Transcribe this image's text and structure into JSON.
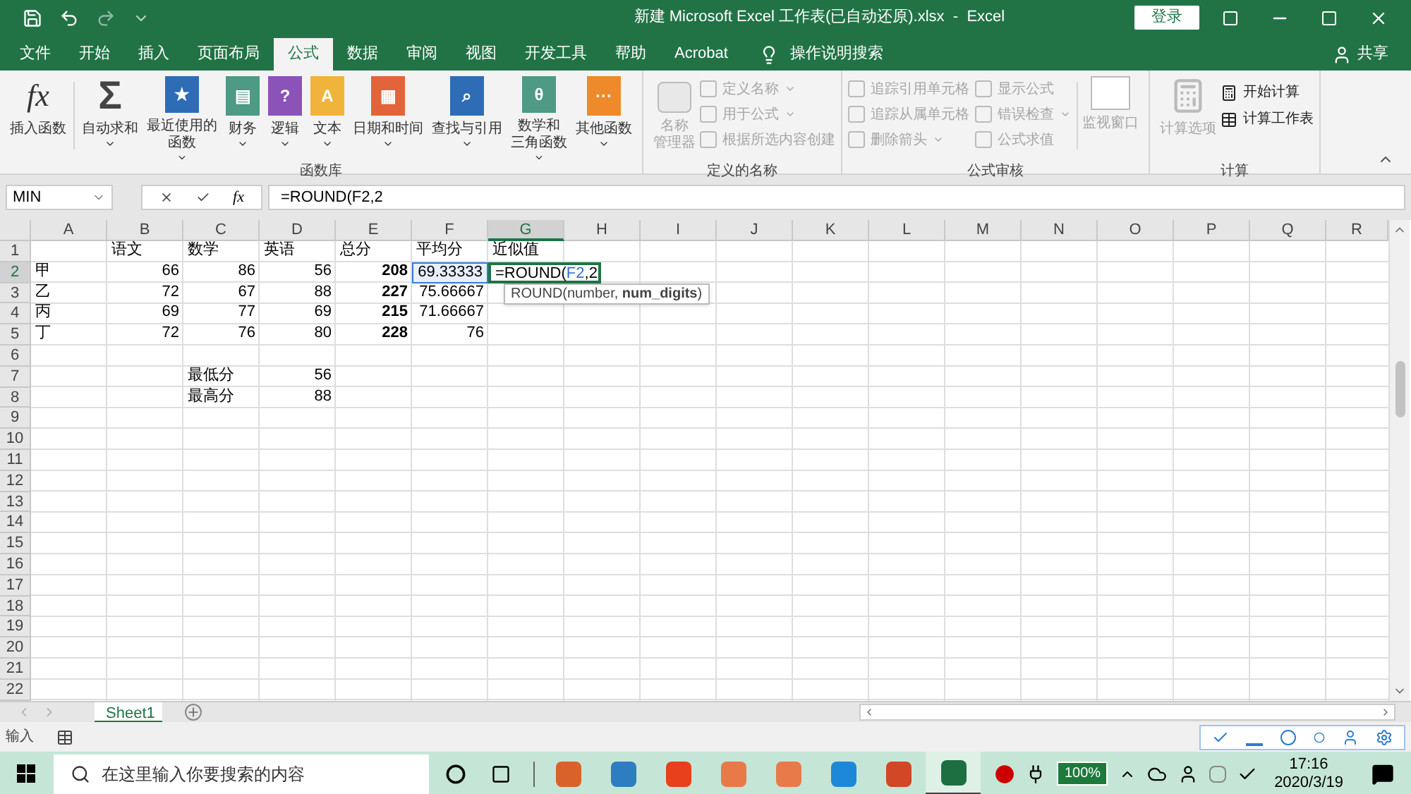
{
  "window": {
    "title": "新建 Microsoft Excel 工作表(已自动还原).xlsx  -  Excel",
    "signin": "登录"
  },
  "tabs": [
    {
      "label": "文件",
      "selected": false
    },
    {
      "label": "开始",
      "selected": false
    },
    {
      "label": "插入",
      "selected": false
    },
    {
      "label": "页面布局",
      "selected": false
    },
    {
      "label": "公式",
      "selected": true
    },
    {
      "label": "数据",
      "selected": false
    },
    {
      "label": "审阅",
      "selected": false
    },
    {
      "label": "视图",
      "selected": false
    },
    {
      "label": "开发工具",
      "selected": false
    },
    {
      "label": "帮助",
      "selected": false
    },
    {
      "label": "Acrobat",
      "selected": false
    }
  ],
  "tell_me": "操作说明搜索",
  "share": "共享",
  "ribbon": {
    "function_library": {
      "title": "函数库",
      "insert": {
        "lines": [
          "插入函数"
        ],
        "glyph": "fx"
      },
      "buttons": [
        {
          "lines": [
            "自动求和"
          ],
          "glyph": "Σ",
          "color": "#444444",
          "dropdown": true
        },
        {
          "lines": [
            "最近使用的",
            "函数"
          ],
          "glyph": "★",
          "color": "#2e6db5",
          "dropdown": true
        },
        {
          "lines": [
            "财务"
          ],
          "glyph": "▤",
          "color": "#4e9a84",
          "dropdown": true
        },
        {
          "lines": [
            "逻辑"
          ],
          "glyph": "?",
          "color": "#8b52b8",
          "dropdown": true
        },
        {
          "lines": [
            "文本"
          ],
          "glyph": "A",
          "color": "#f0b43c",
          "dropdown": true
        },
        {
          "lines": [
            "日期和时间"
          ],
          "glyph": "▦",
          "color": "#e2643a",
          "dropdown": true
        },
        {
          "lines": [
            "查找与引用"
          ],
          "glyph": "⌕",
          "color": "#2e6db5",
          "dropdown": true
        },
        {
          "lines": [
            "数学和",
            "三角函数"
          ],
          "glyph": "θ",
          "color": "#4e9a84",
          "dropdown": true
        },
        {
          "lines": [
            "其他函数"
          ],
          "glyph": "···",
          "color": "#ee8a2a",
          "dropdown": true
        }
      ]
    },
    "defined_names": {
      "title": "定义的名称",
      "manager": {
        "lines": [
          "名称",
          "管理器"
        ],
        "disabled": true
      },
      "items": [
        {
          "label": "定义名称",
          "dropdown": true,
          "disabled": true
        },
        {
          "label": "用于公式",
          "dropdown": true,
          "disabled": true
        },
        {
          "label": "根据所选内容创建",
          "dropdown": false,
          "disabled": true
        }
      ]
    },
    "auditing": {
      "title": "公式审核",
      "columns": [
        [
          {
            "label": "追踪引用单元格",
            "dropdown": false,
            "disabled": true
          },
          {
            "label": "追踪从属单元格",
            "dropdown": false,
            "disabled": true
          },
          {
            "label": "删除箭头",
            "dropdown": true,
            "disabled": true
          }
        ],
        [
          {
            "label": "显示公式",
            "dropdown": false,
            "disabled": true
          },
          {
            "label": "错误检查",
            "dropdown": true,
            "disabled": true
          },
          {
            "label": "公式求值",
            "dropdown": false,
            "disabled": true
          }
        ]
      ],
      "watch": {
        "lines": [
          "监视窗口"
        ],
        "disabled": true
      }
    },
    "calculation": {
      "title": "计算",
      "options": {
        "lines": [
          "计算选项"
        ],
        "disabled": true
      },
      "items": [
        {
          "label": "开始计算",
          "disabled": false
        },
        {
          "label": "计算工作表",
          "disabled": false
        }
      ]
    }
  },
  "formula_bar": {
    "name_box": "MIN",
    "fx": "fx",
    "formula": "=ROUND(F2,2"
  },
  "sheet": {
    "columns": [
      {
        "letter": "A",
        "selected": false
      },
      {
        "letter": "B",
        "selected": false
      },
      {
        "letter": "C",
        "selected": false
      },
      {
        "letter": "D",
        "selected": false
      },
      {
        "letter": "E",
        "selected": false
      },
      {
        "letter": "F",
        "selected": false
      },
      {
        "letter": "G",
        "selected": true
      },
      {
        "letter": "H",
        "selected": false
      },
      {
        "letter": "I",
        "selected": false
      },
      {
        "letter": "J",
        "selected": false
      },
      {
        "letter": "K",
        "selected": false
      },
      {
        "letter": "L",
        "selected": false
      },
      {
        "letter": "M",
        "selected": false
      },
      {
        "letter": "N",
        "selected": false
      },
      {
        "letter": "O",
        "selected": false
      },
      {
        "letter": "P",
        "selected": false
      },
      {
        "letter": "Q",
        "selected": false
      },
      {
        "letter": "R",
        "selected": false
      }
    ],
    "rows": [
      {
        "number": "1",
        "selected": false,
        "cells": {
          "B": {
            "text": "语文",
            "bold": false
          },
          "C": {
            "text": "数学",
            "bold": false
          },
          "D": {
            "text": "英语",
            "bold": false
          },
          "E": {
            "text": "总分",
            "bold": false
          },
          "F": {
            "text": "平均分",
            "bold": false
          },
          "G": {
            "text": "近似值",
            "bold": false
          }
        }
      },
      {
        "number": "2",
        "selected": true,
        "cells": {
          "A": {
            "text": "甲",
            "bold": false
          },
          "B": {
            "text": "66",
            "bold": false
          },
          "C": {
            "text": "86",
            "bold": false
          },
          "D": {
            "text": "56",
            "bold": false
          },
          "E": {
            "text": "208",
            "bold": true
          },
          "F": {
            "text": "69.33333",
            "bold": false,
            "reference": true
          },
          "G": {
            "parts": [
              {
                "text": "=ROUND(",
                "kind": "plain"
              },
              {
                "text": "F2",
                "kind": "reference"
              },
              {
                "text": ",2",
                "kind": "plain"
              }
            ],
            "bold": false,
            "editing": true
          }
        }
      },
      {
        "number": "3",
        "selected": false,
        "cells": {
          "A": {
            "text": "乙",
            "bold": false
          },
          "B": {
            "text": "72",
            "bold": false
          },
          "C": {
            "text": "67",
            "bold": false
          },
          "D": {
            "text": "88",
            "bold": false
          },
          "E": {
            "text": "227",
            "bold": true
          },
          "F": {
            "text": "75.66667",
            "bold": false
          }
        }
      },
      {
        "number": "4",
        "selected": false,
        "cells": {
          "A": {
            "text": "丙",
            "bold": false
          },
          "B": {
            "text": "69",
            "bold": false
          },
          "C": {
            "text": "77",
            "bold": false
          },
          "D": {
            "text": "69",
            "bold": false
          },
          "E": {
            "text": "215",
            "bold": true
          },
          "F": {
            "text": "71.66667",
            "bold": false
          }
        }
      },
      {
        "number": "5",
        "selected": false,
        "cells": {
          "A": {
            "text": "丁",
            "bold": false
          },
          "B": {
            "text": "72",
            "bold": false
          },
          "C": {
            "text": "76",
            "bold": false
          },
          "D": {
            "text": "80",
            "bold": false
          },
          "E": {
            "text": "228",
            "bold": true
          },
          "F": {
            "text": "76",
            "bold": false
          }
        }
      },
      {
        "number": "6",
        "selected": false,
        "cells": {}
      },
      {
        "number": "7",
        "selected": false,
        "cells": {
          "C": {
            "text": "最低分",
            "bold": false
          },
          "D": {
            "text": "56",
            "bold": false
          }
        }
      },
      {
        "number": "8",
        "selected": false,
        "cells": {
          "C": {
            "text": "最高分",
            "bold": false
          },
          "D": {
            "text": "88",
            "bold": false
          }
        }
      },
      {
        "number": "9",
        "selected": false,
        "cells": {}
      },
      {
        "number": "10",
        "selected": false,
        "cells": {}
      },
      {
        "number": "11",
        "selected": false,
        "cells": {}
      },
      {
        "number": "12",
        "selected": false,
        "cells": {}
      },
      {
        "number": "13",
        "selected": false,
        "cells": {}
      },
      {
        "number": "14",
        "selected": false,
        "cells": {}
      },
      {
        "number": "15",
        "selected": false,
        "cells": {}
      },
      {
        "number": "16",
        "selected": false,
        "cells": {}
      },
      {
        "number": "17",
        "selected": false,
        "cells": {}
      },
      {
        "number": "18",
        "selected": false,
        "cells": {}
      },
      {
        "number": "19",
        "selected": false,
        "cells": {}
      },
      {
        "number": "20",
        "selected": false,
        "cells": {}
      },
      {
        "number": "21",
        "selected": false,
        "cells": {}
      },
      {
        "number": "22",
        "selected": false,
        "cells": {}
      }
    ],
    "tooltip": "ROUND(number, **num_digits**)"
  },
  "sheet_tabs": [
    {
      "label": "Sheet1",
      "selected": true
    }
  ],
  "status_bar": {
    "mode": "输入"
  },
  "taskbar": {
    "search_placeholder": "在这里输入你要搜索的内容",
    "apps": [
      {
        "color": "#d9622b",
        "active": false
      },
      {
        "color": "#2e7dc0",
        "active": false
      },
      {
        "color": "#e8401c",
        "active": false
      },
      {
        "color": "#e87a4a",
        "active": false
      },
      {
        "color": "#e87a4a",
        "active": false
      },
      {
        "color": "#1e88d8",
        "active": false
      },
      {
        "color": "#d24726",
        "active": false
      },
      {
        "color": "#1d6f42",
        "active": true
      }
    ],
    "battery": "100%",
    "time": "17:16",
    "date": "2020/3/19"
  }
}
